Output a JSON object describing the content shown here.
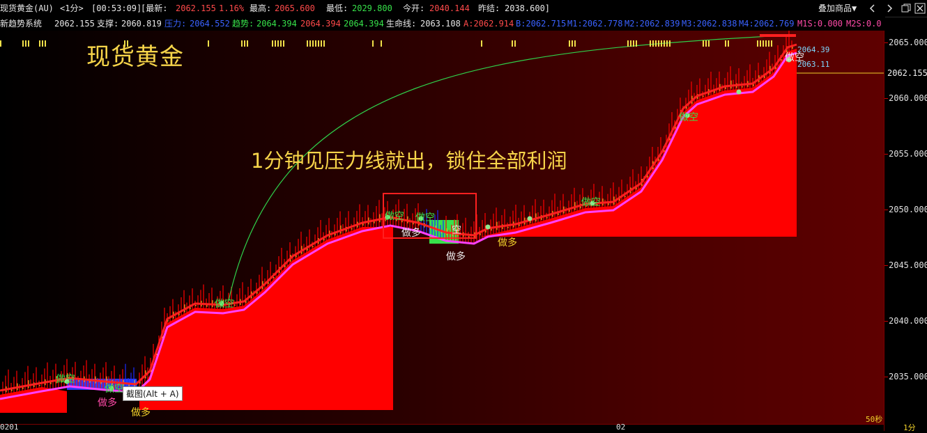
{
  "header": {
    "symbol": "现货黄金(AU)",
    "period": "<1分>",
    "time": "[00:53:09]",
    "latest_label": "[最新:",
    "latest_value": "2062.155",
    "change_pct": "1.16%",
    "high_label": "最高:",
    "high_value": "2065.600",
    "low_label": "最低:",
    "low_value": "2029.800",
    "open_label": "今开:",
    "open_value": "2040.144",
    "prev_label": "昨结:",
    "prev_value": "2038.600]",
    "overlay_button": "叠加商品▼"
  },
  "indicator": {
    "name": "新趋势系统",
    "price": "2062.155",
    "support_label": "支撑:",
    "support_value": "2060.819",
    "pressure_label": "压力:",
    "pressure_value": "2064.552",
    "trend_label": "趋势:",
    "trend_value": "2064.394",
    "v2": "2064.394",
    "v3": "2064.394",
    "life_label": "生命线:",
    "life_value": "2063.108",
    "a": "A:2062.914",
    "b": "B:2062.715",
    "m1": "M1:2062.778",
    "m2": "M2:2062.839",
    "m3": "M3:2062.838",
    "m4": "M4:2062.769",
    "m1s": "M1S:0.000",
    "m2s": "M2S:0.0"
  },
  "chart": {
    "title": "现货黄金",
    "annotation": "1分钟见压力线就出，锁住全部利润",
    "tooltip": "截图(Alt + A)",
    "right_label_1": "2064.39",
    "right_label_2": "2063.11",
    "signal_short": "做空",
    "signal_long": "做多",
    "signal_short_mark": "空",
    "current_price": "2062.155"
  },
  "price_axis": {
    "ticks": [
      "2065.000",
      "2060.000",
      "2055.000",
      "2050.000",
      "2045.000",
      "2040.000",
      "2035.000"
    ]
  },
  "time_axis": {
    "labels": [
      "0201",
      "02"
    ],
    "interval": "50秒",
    "unit": "1分"
  },
  "colors": {
    "bull": "#ff0000",
    "bear": "#0000ff",
    "upper": "#ff2020",
    "lower": "#ff40ff",
    "signal": "#37e24a",
    "gold": "#f7d54a"
  }
}
